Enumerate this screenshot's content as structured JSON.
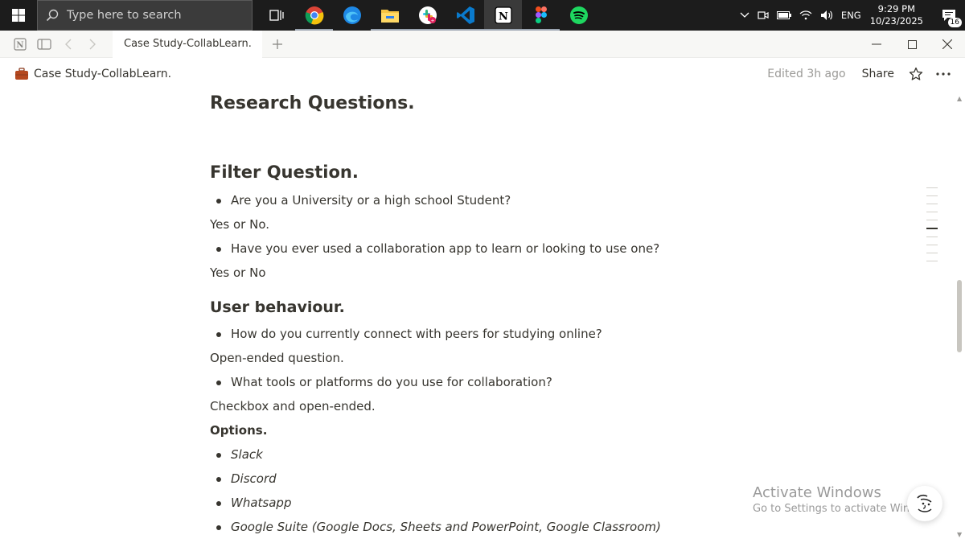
{
  "taskbar": {
    "search_placeholder": "Type here to search",
    "apps": [
      "task-view",
      "chrome",
      "edge",
      "file-explorer",
      "slack",
      "vscode",
      "notion",
      "figma",
      "spotify"
    ],
    "tray": {
      "language": "ENG",
      "time": "9:29 PM",
      "date": "10/23/2025",
      "notification_count": "16"
    }
  },
  "titlebar": {
    "tab_title": "Case Study-CollabLearn."
  },
  "topbar": {
    "breadcrumb": "Case Study-CollabLearn.",
    "edited": "Edited 3h ago",
    "share_label": "Share"
  },
  "document": {
    "title_heading": "Research Questions.",
    "filter_heading": "Filter Question.",
    "q1": "Are you a University or a high school Student?",
    "a1": "Yes or No.",
    "q2": "Have you ever used a collaboration app to learn or looking to use one?",
    "a2": "Yes or No",
    "behaviour_heading": "User behaviour.",
    "q3": "How do you currently connect with peers for studying online?",
    "a3": "Open-ended question.",
    "q4": "What tools or platforms do you use for collaboration?",
    "a4": "Checkbox and open-ended.",
    "options_label": "Options.",
    "options": [
      "Slack",
      "Discord",
      "Whatsapp",
      "Google Suite (Google Docs, Sheets and PowerPoint, Google Classroom)"
    ]
  },
  "watermark": {
    "line1": "Activate Windows",
    "line2": "Go to Settings to activate Windows."
  },
  "colors": {
    "taskbar": "#1c1c1c",
    "text": "#37352f",
    "muted": "#9b9a97"
  }
}
